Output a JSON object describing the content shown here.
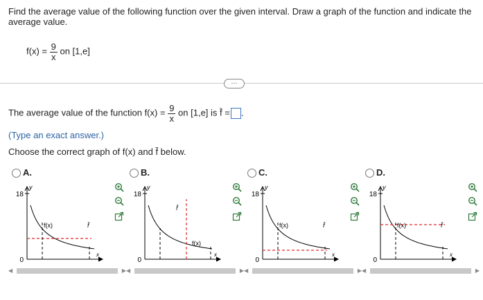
{
  "question": {
    "line1": "Find the average value of the following function over the given interval. Draw a graph of the function and indicate the",
    "line2": "average value.",
    "func_lhs": "f(x) =",
    "func_num": "9",
    "func_den": "x",
    "func_interval": "on [1,e]"
  },
  "ellipsis": "···",
  "answer": {
    "prefix": "The average value of the function f(x) =",
    "num": "9",
    "den": "x",
    "suffix": "on [1,e] is f̄ =",
    "period": ".",
    "hint": "(Type an exact answer.)"
  },
  "choose": "Choose the correct graph of f(x) and f̄ below.",
  "options": [
    {
      "label": "A.",
      "ytop": "18",
      "yzero": "0",
      "func_label": "f(x)",
      "avg_label": "f̄",
      "x_label": "x"
    },
    {
      "label": "B.",
      "ytop": "18",
      "yzero": "0",
      "func_label": "f(x)",
      "avg_label": "f̄",
      "x_label": "x"
    },
    {
      "label": "C.",
      "ytop": "18",
      "yzero": "0",
      "func_label": "f(x)",
      "avg_label": "f̄",
      "x_label": "x"
    },
    {
      "label": "D.",
      "ytop": "18",
      "yzero": "0",
      "func_label": "f(x)",
      "avg_label": "f̄",
      "x_label": "x"
    }
  ],
  "y_axis_label": "y",
  "icons": {
    "zoom_in": "zoom-in-icon",
    "zoom_out": "zoom-out-icon",
    "expand": "expand-icon"
  },
  "colors": {
    "dashed": "#e0282b",
    "accent": "#3b76c4"
  }
}
